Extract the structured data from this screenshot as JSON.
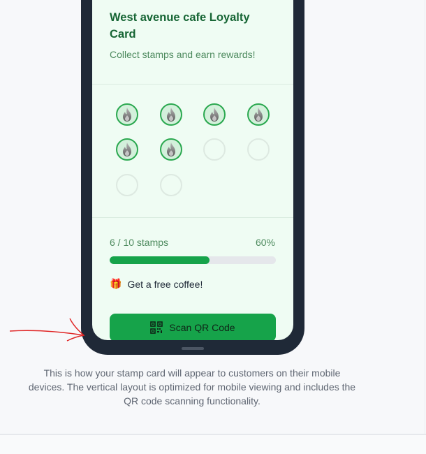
{
  "card": {
    "title": "West avenue cafe Loyalty Card",
    "subtitle": "Collect stamps and earn rewards!",
    "stamps_collected": 6,
    "stamps_total": 10,
    "stamp_icon": "flame-icon",
    "progress_label": "6 / 10 stamps",
    "progress_percent_text": "60%",
    "progress_fraction": 0.6,
    "reward_icon": "gift-icon",
    "reward_text": "Get a free coffee!",
    "scan_button_label": "Scan QR Code",
    "scan_button_icon": "qr-code-icon"
  },
  "caption": "This is how your stamp card will appear to customers on their mobile devices. The vertical layout is optimized for mobile viewing and includes the QR code scanning functionality.",
  "colors": {
    "accent": "#16a34a",
    "card_background": "#effcf3",
    "phone_frame": "#1f2937",
    "annotation_arrow": "#e02424"
  }
}
